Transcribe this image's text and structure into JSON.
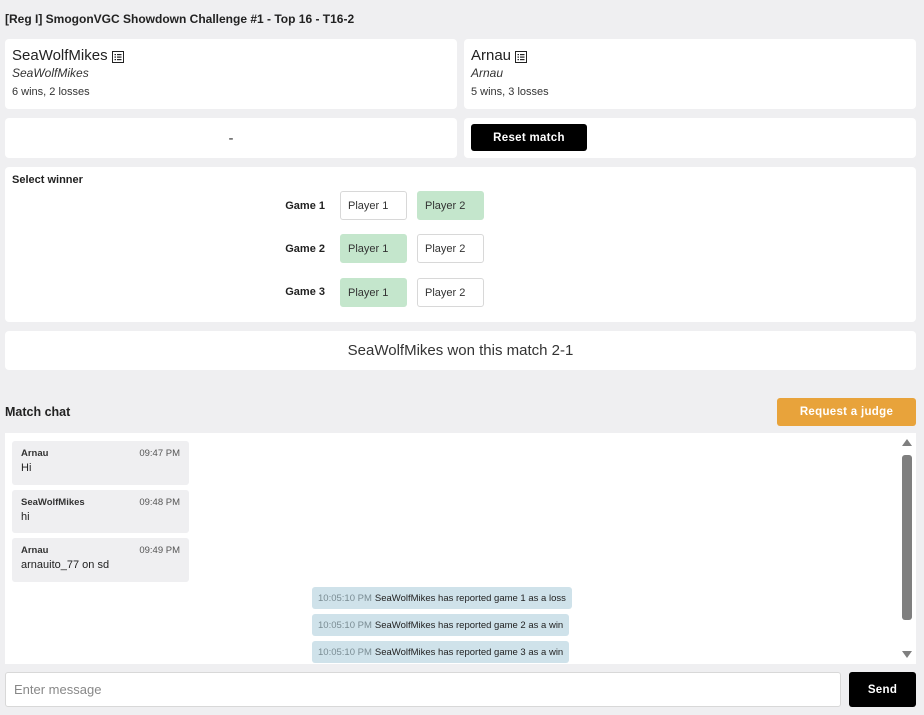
{
  "match": {
    "title": "[Reg I] SmogonVGC Showdown Challenge #1 - Top 16 - T16-2"
  },
  "player1": {
    "name": "SeaWolfMikes",
    "username": "SeaWolfMikes",
    "record": "6 wins, 2 losses",
    "icon": "list-icon"
  },
  "player2": {
    "name": "Arnau",
    "username": "Arnau",
    "record": "5 wins, 3 losses",
    "icon": "list-icon"
  },
  "status": {
    "left": "-",
    "reset_label": "Reset match"
  },
  "winner": {
    "label": "Select winner",
    "games": [
      {
        "label": "Game 1",
        "p1": "Player 1",
        "p2": "Player 2",
        "selected": "p2"
      },
      {
        "label": "Game 2",
        "p1": "Player 1",
        "p2": "Player 2",
        "selected": "p1"
      },
      {
        "label": "Game 3",
        "p1": "Player 1",
        "p2": "Player 2",
        "selected": "p1"
      }
    ],
    "result": "SeaWolfMikes won this match 2-1"
  },
  "chat": {
    "title": "Match chat",
    "judge_label": "Request a judge",
    "messages": [
      {
        "author": "Arnau",
        "time": "09:47 PM",
        "text": "Hi"
      },
      {
        "author": "SeaWolfMikes",
        "time": "09:48 PM",
        "text": "hi"
      },
      {
        "author": "Arnau",
        "time": "09:49 PM",
        "text": "arnauito_77 on sd"
      }
    ],
    "system": [
      {
        "time": "10:05:10 PM",
        "text": "SeaWolfMikes has reported game 1 as a loss"
      },
      {
        "time": "10:05:10 PM",
        "text": "SeaWolfMikes has reported game 2 as a win"
      },
      {
        "time": "10:05:10 PM",
        "text": "SeaWolfMikes has reported game 3 as a win"
      }
    ],
    "input_placeholder": "Enter message",
    "send_label": "Send"
  },
  "colors": {
    "selected_green": "#c4e6cc",
    "judge_orange": "#e8a33b",
    "system_blue": "#cfe2ea",
    "black": "#000000"
  }
}
